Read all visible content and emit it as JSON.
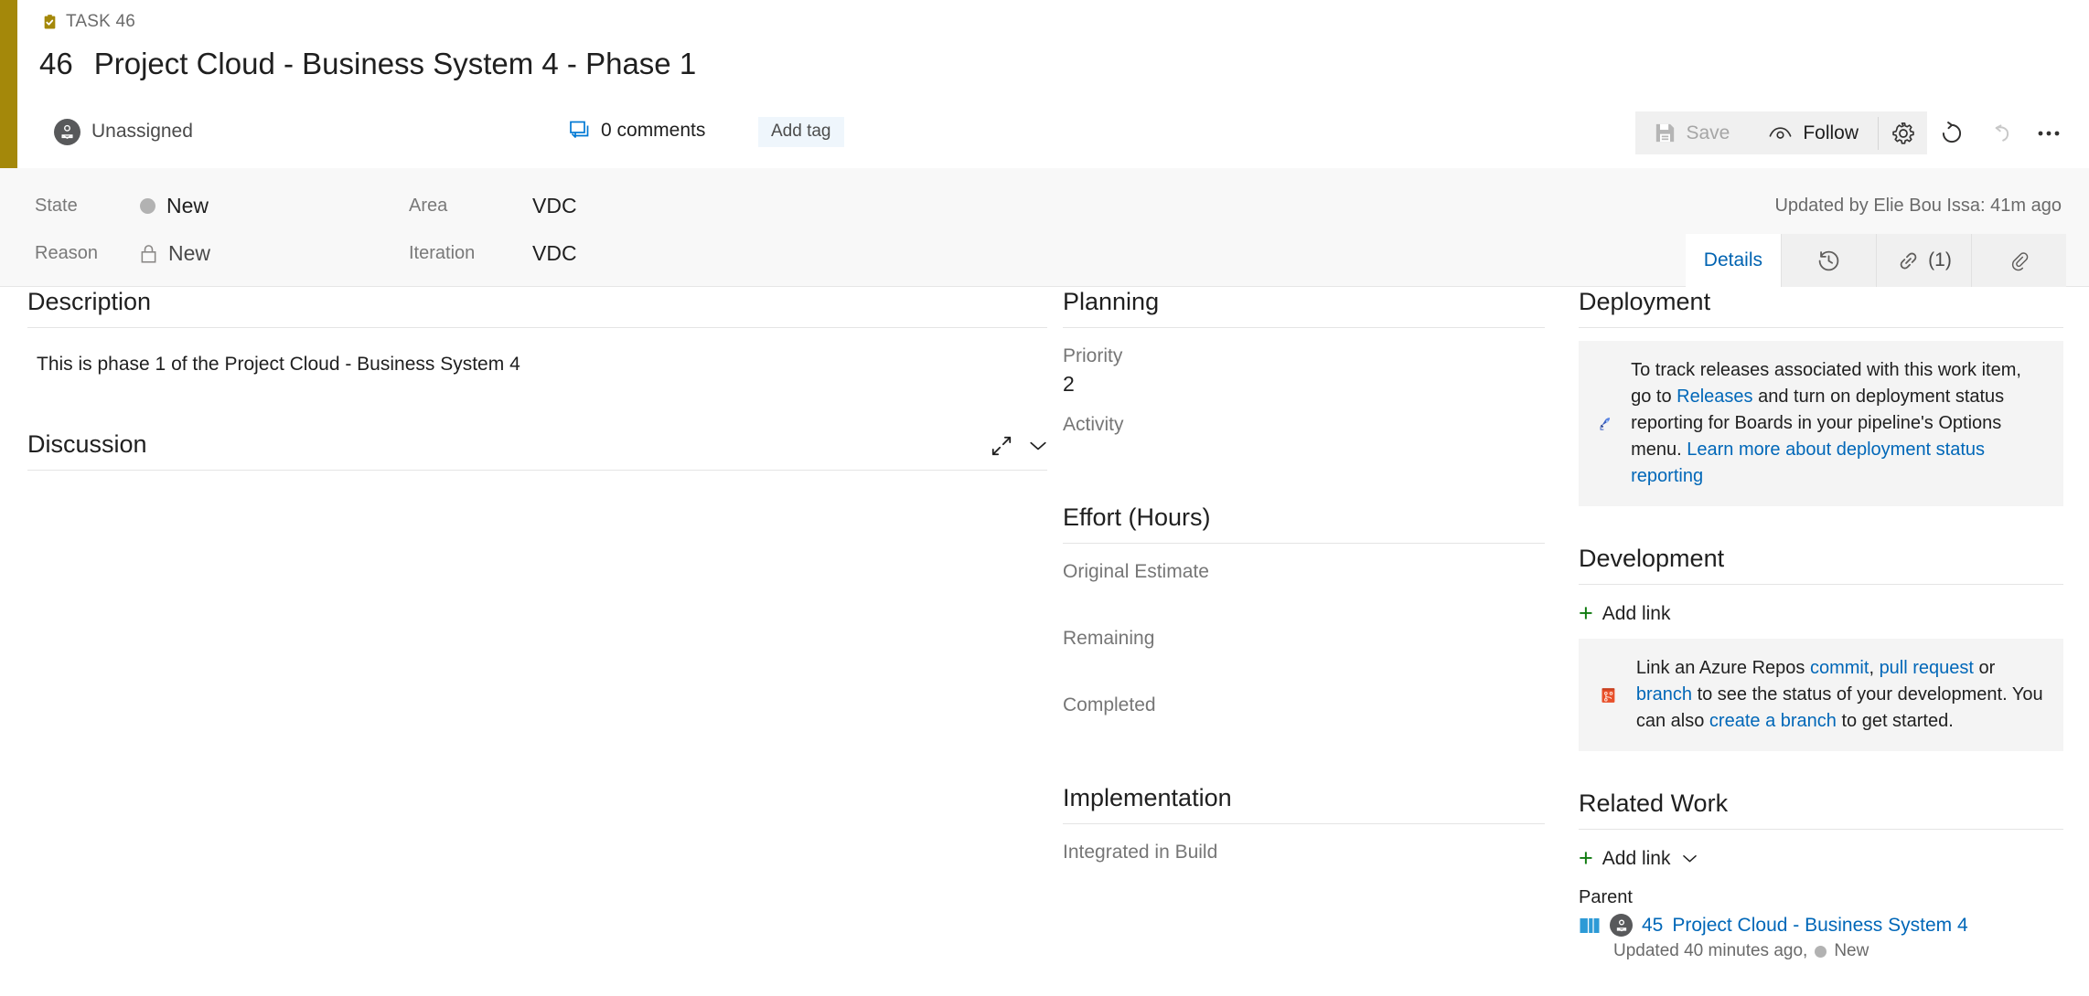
{
  "header": {
    "breadcrumb": "TASK 46",
    "work_item_id": "46",
    "title": "Project Cloud - Business System 4 - Phase 1",
    "assignee": "Unassigned",
    "comments_label": "0 comments",
    "add_tag_label": "Add tag",
    "type_color": "#a4880a"
  },
  "toolbar": {
    "save_label": "Save",
    "follow_label": "Follow",
    "settings_title": "Work item settings",
    "refresh_title": "Refresh",
    "revert_title": "Revert changes",
    "more_title": "More actions"
  },
  "fields": {
    "state_label": "State",
    "state_value": "New",
    "reason_label": "Reason",
    "reason_value": "New",
    "area_label": "Area",
    "area_value": "VDC",
    "iteration_label": "Iteration",
    "iteration_value": "VDC",
    "updated_by": "Updated by Elie Bou Issa: 41m ago"
  },
  "tabs": [
    {
      "label": "Details",
      "name": "tab-details",
      "active": true
    },
    {
      "label": "",
      "name": "tab-history",
      "icon": "history-icon",
      "active": false
    },
    {
      "label": "(1)",
      "name": "tab-links",
      "icon": "link-icon",
      "active": false
    },
    {
      "label": "",
      "name": "tab-attachments",
      "icon": "paperclip-icon",
      "active": false
    }
  ],
  "description": {
    "title": "Description",
    "body": "This is phase 1 of the Project Cloud - Business System 4"
  },
  "discussion": {
    "title": "Discussion"
  },
  "planning": {
    "title": "Planning",
    "priority_label": "Priority",
    "priority_value": "2",
    "activity_label": "Activity",
    "activity_value": ""
  },
  "effort": {
    "title": "Effort (Hours)",
    "original_estimate_label": "Original Estimate",
    "original_estimate_value": "",
    "remaining_label": "Remaining",
    "remaining_value": "",
    "completed_label": "Completed",
    "completed_value": ""
  },
  "implementation": {
    "title": "Implementation",
    "integrated_in_build_label": "Integrated in Build",
    "integrated_in_build_value": ""
  },
  "deployment": {
    "title": "Deployment",
    "text_1": "To track releases associated with this work item, go to ",
    "link_releases": "Releases",
    "text_2": " and turn on deployment status reporting for Boards in your pipeline's Options menu. ",
    "link_learn_more": "Learn more about deployment status reporting"
  },
  "development": {
    "title": "Development",
    "add_link_label": "Add link",
    "text_1": "Link an Azure Repos ",
    "link_commit": "commit",
    "text_sep1": ", ",
    "link_pull_request": "pull request",
    "text_2": " or ",
    "link_branch": "branch",
    "text_3": " to see the status of your development. You can also ",
    "link_create_branch": "create a branch",
    "text_4": " to get started."
  },
  "related_work": {
    "title": "Related Work",
    "add_link_label": "Add link",
    "group_label": "Parent",
    "item_id": "45",
    "item_title": "Project Cloud - Business System 4",
    "item_sub_updated": "Updated 40 minutes ago,",
    "item_sub_state": "New"
  },
  "colors": {
    "accent_link": "#0067b8",
    "task_gold": "#a4880a",
    "add_green": "#0f7b0f",
    "state_gray": "#b2b2b2"
  }
}
